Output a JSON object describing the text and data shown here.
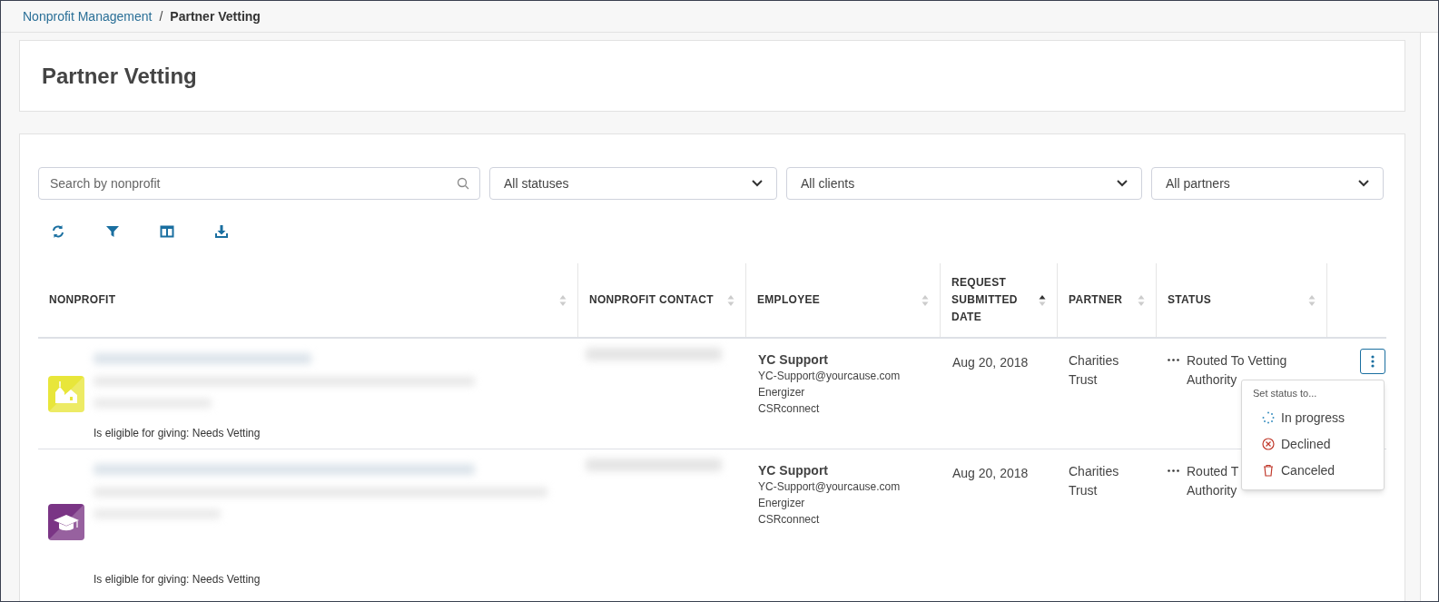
{
  "breadcrumb": [
    {
      "label": "Nonprofit Management",
      "link": true
    },
    {
      "label": "Partner Vetting",
      "link": false
    }
  ],
  "breadcrumb_separator": "/",
  "page_title": "Partner Vetting",
  "filters": {
    "search": {
      "placeholder": "Search by nonprofit"
    },
    "selects": [
      "All statuses",
      "All clients",
      "All partners"
    ]
  },
  "toolbar": [
    {
      "kind": "refresh"
    },
    {
      "kind": "filter"
    },
    {
      "kind": "columns"
    },
    {
      "kind": "download"
    }
  ],
  "table": {
    "columns": [
      {
        "label": "NONPROFIT",
        "sorted": false
      },
      {
        "label": "NONPROFIT CONTACT",
        "sorted": false
      },
      {
        "label": "EMPLOYEE",
        "sorted": false
      },
      {
        "label": "REQUEST SUBMITTED DATE",
        "sorted": true
      },
      {
        "label": "PARTNER",
        "sorted": false
      },
      {
        "label": "STATUS",
        "sorted": false
      }
    ],
    "rows": [
      {
        "kind": "church",
        "color": "#e8e63a",
        "eligibility": "Is eligible for giving: Needs Vetting",
        "employee": {
          "name": "YC Support",
          "email": "YC-Support@yourcause.com",
          "company": "Energizer",
          "program": "CSRconnect"
        },
        "date": "Aug 20, 2018",
        "partner": [
          "Charities",
          "Trust"
        ],
        "status": [
          "Routed To Vetting",
          "Authority"
        ]
      },
      {
        "kind": "graduation",
        "color": "#7a3585",
        "eligibility": "Is eligible for giving: Needs Vetting",
        "employee": {
          "name": "YC Support",
          "email": "YC-Support@yourcause.com",
          "company": "Energizer",
          "program": "CSRconnect"
        },
        "date": "Aug 20, 2018",
        "partner": [
          "Charities",
          "Trust"
        ],
        "status": [
          "Routed T",
          "Authority"
        ]
      }
    ]
  },
  "status_menu": {
    "heading": "Set status to...",
    "items": [
      {
        "kind": "progress",
        "label": "In progress"
      },
      {
        "kind": "declined",
        "label": "Declined"
      },
      {
        "kind": "canceled",
        "label": "Canceled"
      }
    ]
  }
}
